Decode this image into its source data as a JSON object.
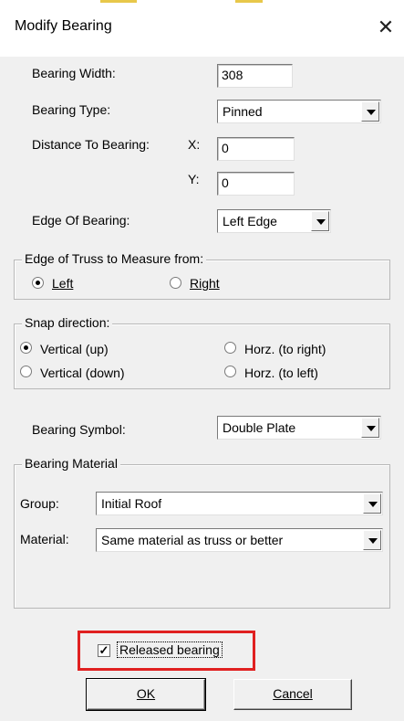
{
  "window": {
    "title": "Modify Bearing",
    "close_glyph": "✕"
  },
  "bearing_width": {
    "label": "Bearing Width:",
    "value": "308"
  },
  "bearing_type": {
    "label": "Bearing Type:",
    "value": "Pinned"
  },
  "distance": {
    "label": "Distance To Bearing:",
    "x_label": "X:",
    "x_value": "0",
    "y_label": "Y:",
    "y_value": "0"
  },
  "edge_of_bearing": {
    "label": "Edge Of Bearing:",
    "value": "Left Edge"
  },
  "edge_of_truss": {
    "title": "Edge of Truss to Measure from:",
    "left_label": "Left",
    "right_label": "Right",
    "selected": "Left"
  },
  "snap_direction": {
    "title": "Snap direction:",
    "options": [
      "Vertical (up)",
      "Horz. (to right)",
      "Vertical (down)",
      "Horz. (to left)"
    ],
    "selected": "Vertical (up)"
  },
  "bearing_symbol": {
    "label": "Bearing Symbol:",
    "value": "Double Plate"
  },
  "bearing_material": {
    "title": "Bearing Material",
    "group_label": "Group:",
    "group_value": "Initial Roof",
    "material_label": "Material:",
    "material_value": "Same material as truss or better"
  },
  "released_bearing": {
    "label": "Released bearing",
    "checked": true,
    "check_glyph": "✓",
    "highlight_color": "#e02020"
  },
  "buttons": {
    "ok": "OK",
    "cancel": "Cancel"
  },
  "colors": {
    "background": "#f0f0f0",
    "titlebar": "#ffffff",
    "highlight": "#e02020"
  }
}
